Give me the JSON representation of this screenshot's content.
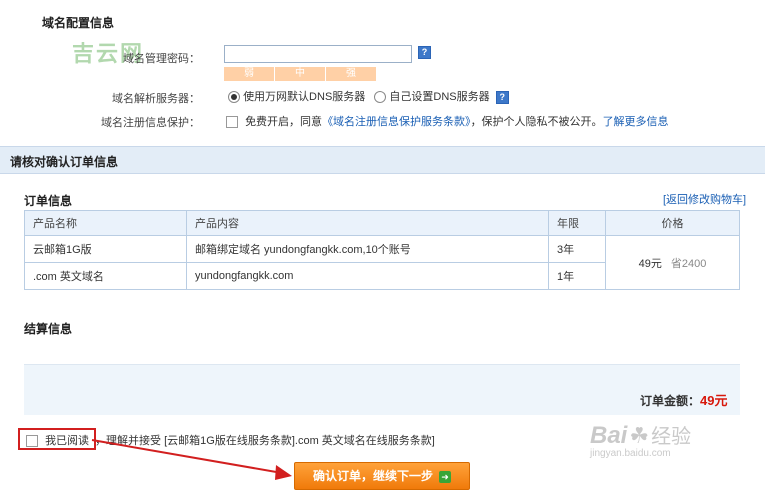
{
  "domain_config": {
    "title": "域名配置信息",
    "password_label": "域名管理密码：",
    "password_value": "",
    "strength": [
      "弱",
      "中",
      "强"
    ],
    "dns_label": "域名解析服务器：",
    "dns_option_default": "使用万网默认DNS服务器",
    "dns_option_custom": "自己设置DNS服务器",
    "privacy_label": "域名注册信息保护：",
    "privacy_text_pre": "免费开启，同意",
    "privacy_terms_link": "《域名注册信息保护服务条款》",
    "privacy_text_post": "，保护个人隐私不被公开。",
    "privacy_more_link": "了解更多信息"
  },
  "watermark_logo": "吉云网",
  "confirm": {
    "band_title": "请核对确认订单信息",
    "order_title": "订单信息",
    "back_link": "[返回修改购物车]",
    "columns": [
      "产品名称",
      "产品内容",
      "年限",
      "价格"
    ],
    "rows": [
      {
        "name": "云邮箱1G版",
        "content": "邮箱绑定域名 yundongfangkk.com,10个账号",
        "years": "3年"
      },
      {
        "name": ".com 英文域名",
        "content": "yundongfangkk.com",
        "years": "1年"
      }
    ],
    "price": "49元",
    "saved": "省2400"
  },
  "settlement": {
    "title": "结算信息",
    "total_label": "订单金额：",
    "total_value": "49元"
  },
  "agreement": {
    "read_label": "我已阅读",
    "text": "，理解并接受 [云邮箱1G版在线服务条款].com 英文域名在线服务条款]"
  },
  "submit_button": "确认订单，继续下一步",
  "baidu_watermark": {
    "brand": "Bai",
    "jingyan": "经验",
    "url": "jingyan.baidu.com"
  },
  "colors": {
    "accent": "#f07a0a",
    "amount": "#d7170b",
    "link": "#1a5fb4",
    "annotation": "#d21f1f"
  }
}
